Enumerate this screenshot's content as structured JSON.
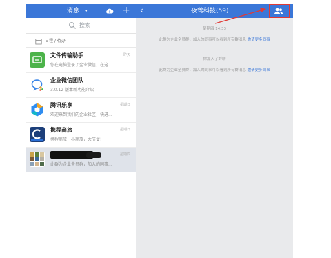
{
  "topbar": {
    "messages_label": "消息",
    "dropdown_caret": "▾",
    "plus": "+",
    "back": "‹",
    "chat_title": "夜莺科技(59)"
  },
  "search": {
    "placeholder": "搜索"
  },
  "agenda": {
    "label": "日程 / 待办"
  },
  "conversations": [
    {
      "name": "文件传输助手",
      "time": "昨天",
      "preview": "你在电脑登录了企业微信，在这..."
    },
    {
      "name": "企业微信团队",
      "time": "",
      "preview": "3.0.12 版本新功能介绍"
    },
    {
      "name": "腾讯乐享",
      "time": "星期日",
      "preview": "欢迎来到我们的企业社区，快进..."
    },
    {
      "name": "携程商旅",
      "time": "星期日",
      "preview": "携程商旅，小商旅，大节省!"
    },
    {
      "name": "",
      "time": "星期四",
      "preview": "此群为企业全员群，加入的同事..."
    }
  ],
  "chat": {
    "date": "星期四 14:33",
    "notice1_text": "此群为企业全员群，加入的同事可以看到所有群消息",
    "notice1_link": "邀请更多同事",
    "joined": "你加入了群聊",
    "notice2_text": "此群为企业全员群，加入的同事可以看到所有群消息",
    "notice2_link": "邀请更多同事"
  },
  "colors": {
    "accent": "#3b77d8",
    "highlight": "#e03a36"
  }
}
